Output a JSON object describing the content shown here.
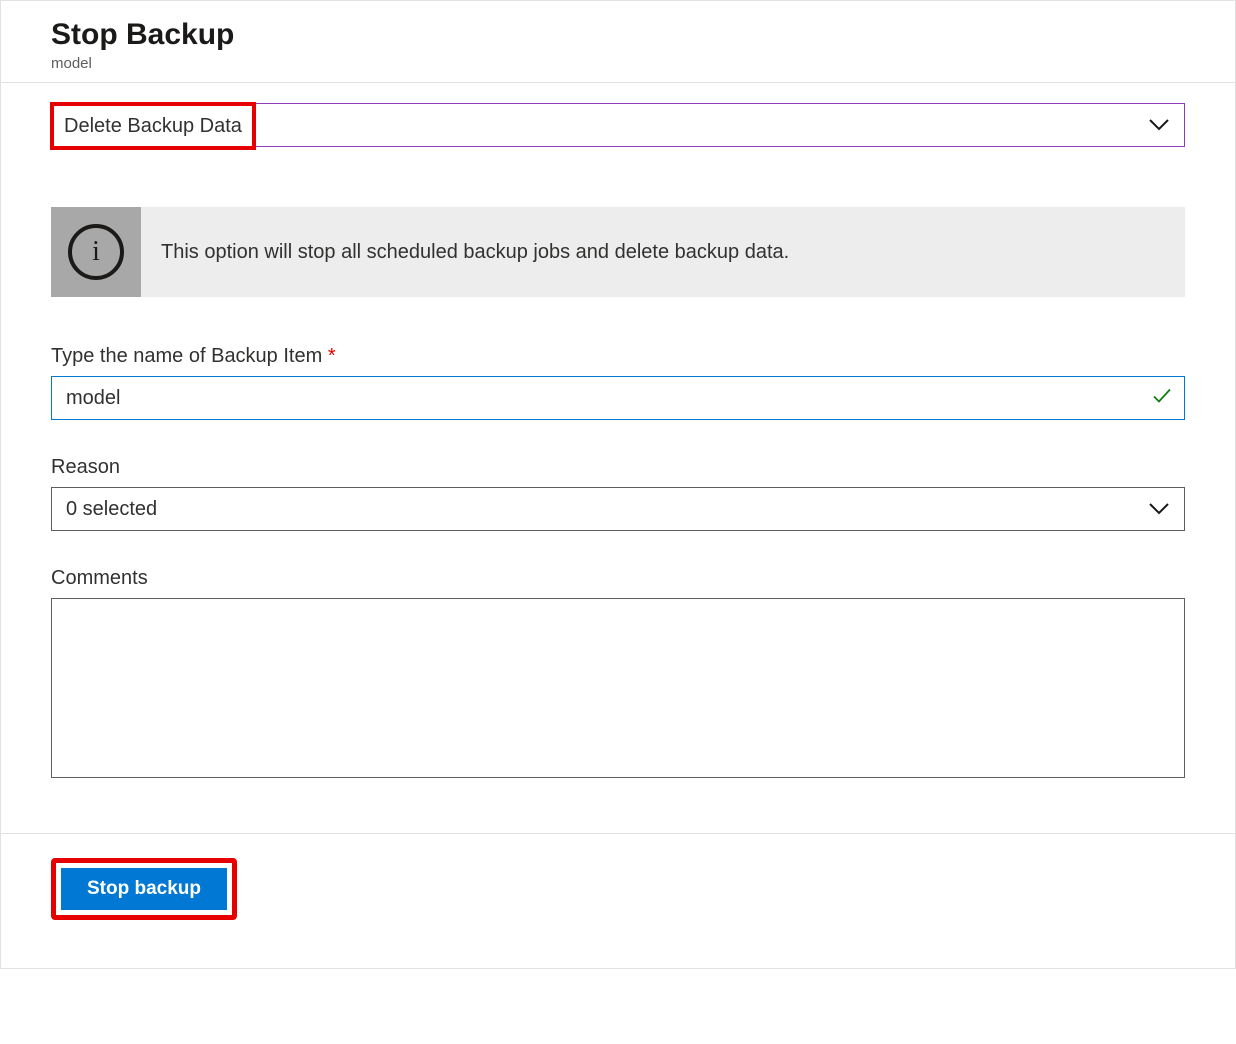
{
  "header": {
    "title": "Stop Backup",
    "subtitle": "model"
  },
  "action_select": {
    "value": "Delete Backup Data"
  },
  "info": {
    "text": "This option will stop all scheduled backup jobs and delete backup data."
  },
  "fields": {
    "name_label": "Type the name of Backup Item",
    "name_value": "model",
    "reason_label": "Reason",
    "reason_value": "0 selected",
    "comments_label": "Comments",
    "comments_value": ""
  },
  "footer": {
    "stop_button": "Stop backup"
  }
}
